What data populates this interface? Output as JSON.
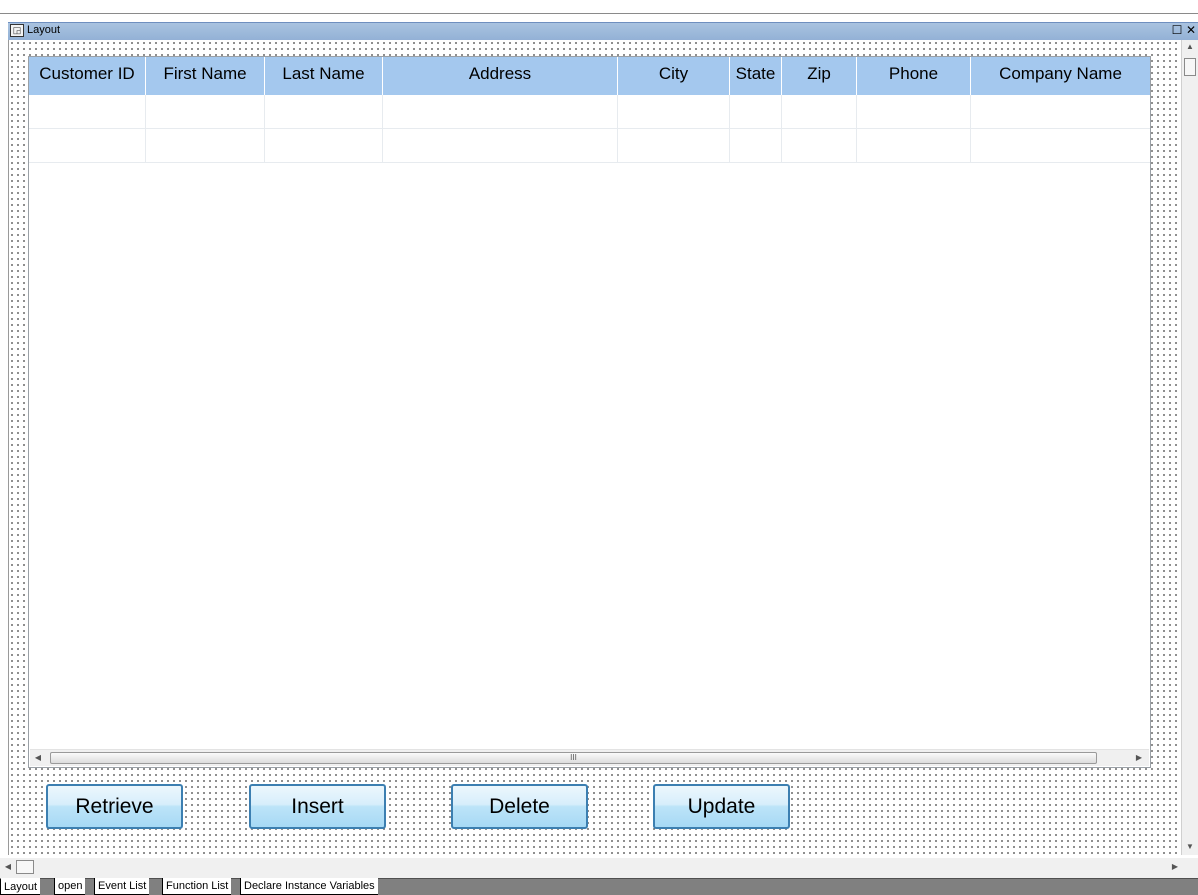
{
  "window": {
    "title": "Layout",
    "restore_glyph": "☐",
    "close_glyph": "✕"
  },
  "grid": {
    "columns": [
      {
        "key": "customer_id",
        "label": "Customer ID"
      },
      {
        "key": "first_name",
        "label": "First Name"
      },
      {
        "key": "last_name",
        "label": "Last Name"
      },
      {
        "key": "address",
        "label": "Address"
      },
      {
        "key": "city",
        "label": "City"
      },
      {
        "key": "state",
        "label": "State"
      },
      {
        "key": "zip",
        "label": "Zip"
      },
      {
        "key": "phone",
        "label": "Phone"
      },
      {
        "key": "company_name",
        "label": "Company Name"
      }
    ],
    "rows": [
      [
        "",
        "",
        "",
        "",
        "",
        "",
        "",
        "",
        ""
      ],
      [
        "",
        "",
        "",
        "",
        "",
        "",
        "",
        "",
        ""
      ]
    ],
    "hscroll_grip": "III"
  },
  "buttons": {
    "retrieve": "Retrieve",
    "insert": "Insert",
    "delete": "Delete",
    "update": "Update"
  },
  "tabs": [
    {
      "label": "Layout",
      "active": true
    },
    {
      "label": "open",
      "active": false
    },
    {
      "label": "Event List",
      "active": false
    },
    {
      "label": "Function List",
      "active": false
    },
    {
      "label": "Declare Instance Variables",
      "active": false
    }
  ],
  "colors": {
    "header_bg": "#a4c8ee",
    "titlebar_bg": "#a9c3e0",
    "button_border": "#3c7fb1"
  }
}
